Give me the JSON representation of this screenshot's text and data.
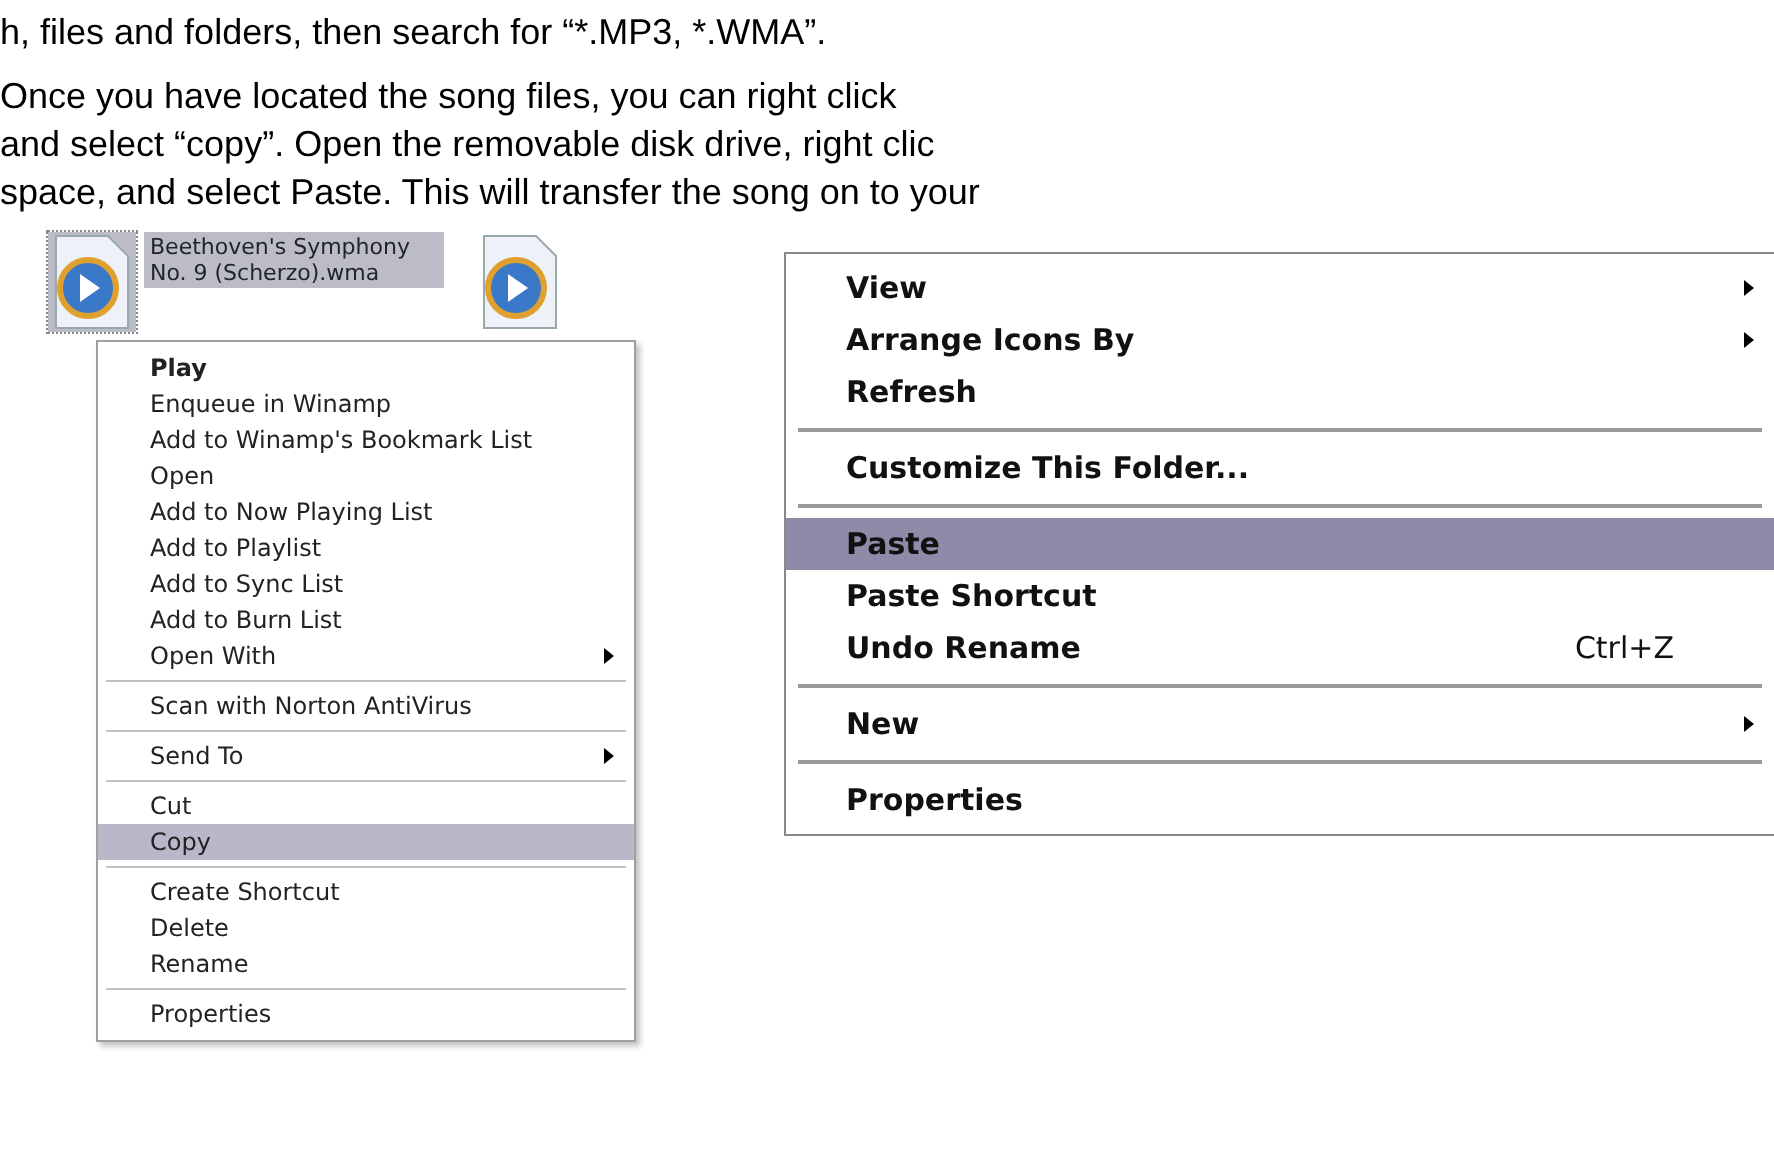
{
  "document": {
    "paragraphs": [
      {
        "lines": [
          "h, files and folders, then search for “*.MP3, *.WMA”."
        ]
      },
      {
        "lines": [
          "Once you have located the song files, you can right click",
          "and select “copy”. Open the removable disk drive, right clic",
          "space, and select Paste. This will transfer the song on to your"
        ]
      }
    ]
  },
  "files": [
    {
      "label": "Beethoven's Symphony No. 9 (Scherzo).wma",
      "selected": true
    },
    {
      "selected": false
    }
  ],
  "file_menu": {
    "items": [
      {
        "kind": "item",
        "label": "Play",
        "default": true,
        "submenu": false,
        "selected": false
      },
      {
        "kind": "item",
        "label": "Enqueue in Winamp",
        "default": false,
        "submenu": false,
        "selected": false
      },
      {
        "kind": "item",
        "label": "Add to Winamp's Bookmark List",
        "default": false,
        "submenu": false,
        "selected": false
      },
      {
        "kind": "item",
        "label": "Open",
        "default": false,
        "submenu": false,
        "selected": false
      },
      {
        "kind": "item",
        "label": "Add to Now Playing List",
        "default": false,
        "submenu": false,
        "selected": false
      },
      {
        "kind": "item",
        "label": "Add to Playlist",
        "default": false,
        "submenu": false,
        "selected": false
      },
      {
        "kind": "item",
        "label": "Add to Sync List",
        "default": false,
        "submenu": false,
        "selected": false
      },
      {
        "kind": "item",
        "label": "Add to Burn List",
        "default": false,
        "submenu": false,
        "selected": false
      },
      {
        "kind": "item",
        "label": "Open With",
        "default": false,
        "submenu": true,
        "selected": false
      },
      {
        "kind": "separator"
      },
      {
        "kind": "item",
        "label": "Scan with Norton AntiVirus",
        "default": false,
        "submenu": false,
        "selected": false
      },
      {
        "kind": "separator"
      },
      {
        "kind": "item",
        "label": "Send To",
        "default": false,
        "submenu": true,
        "selected": false
      },
      {
        "kind": "separator"
      },
      {
        "kind": "item",
        "label": "Cut",
        "default": false,
        "submenu": false,
        "selected": false
      },
      {
        "kind": "item",
        "label": "Copy",
        "default": false,
        "submenu": false,
        "selected": true
      },
      {
        "kind": "separator"
      },
      {
        "kind": "item",
        "label": "Create Shortcut",
        "default": false,
        "submenu": false,
        "selected": false
      },
      {
        "kind": "item",
        "label": "Delete",
        "default": false,
        "submenu": false,
        "selected": false
      },
      {
        "kind": "item",
        "label": "Rename",
        "default": false,
        "submenu": false,
        "selected": false
      },
      {
        "kind": "separator"
      },
      {
        "kind": "item",
        "label": "Properties",
        "default": false,
        "submenu": false,
        "selected": false
      }
    ]
  },
  "folder_menu": {
    "items": [
      {
        "kind": "item",
        "label": "View",
        "submenu": true,
        "selected": false
      },
      {
        "kind": "item",
        "label": "Arrange Icons By",
        "submenu": true,
        "selected": false
      },
      {
        "kind": "item",
        "label": "Refresh",
        "submenu": false,
        "selected": false
      },
      {
        "kind": "separator"
      },
      {
        "kind": "item",
        "label": "Customize This Folder...",
        "submenu": false,
        "selected": false
      },
      {
        "kind": "separator"
      },
      {
        "kind": "item",
        "label": "Paste",
        "submenu": false,
        "selected": true
      },
      {
        "kind": "item",
        "label": "Paste Shortcut",
        "submenu": false,
        "selected": false
      },
      {
        "kind": "item",
        "label": "Undo Rename",
        "shortcut": "Ctrl+Z",
        "submenu": false,
        "selected": false
      },
      {
        "kind": "separator"
      },
      {
        "kind": "item",
        "label": "New",
        "submenu": true,
        "selected": false
      },
      {
        "kind": "separator"
      },
      {
        "kind": "item",
        "label": "Properties",
        "submenu": false,
        "selected": false
      }
    ]
  }
}
